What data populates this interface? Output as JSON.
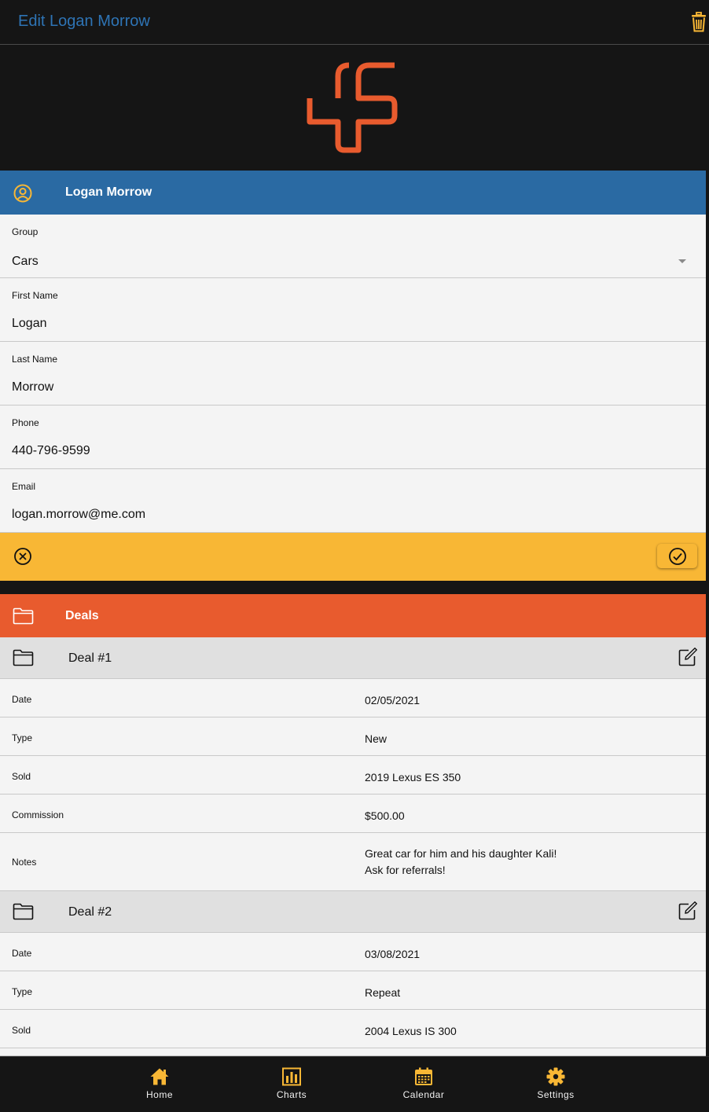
{
  "header": {
    "title": "Edit Logan Morrow",
    "delete_icon": "trash-icon"
  },
  "logo": {
    "icon": "brand-logo",
    "color": "#e85b2e"
  },
  "contact": {
    "section_title": "Logan Morrow",
    "section_icon": "user-circle-icon",
    "fields": {
      "group": {
        "label": "Group",
        "value": "Cars"
      },
      "first_name": {
        "label": "First Name",
        "value": "Logan"
      },
      "last_name": {
        "label": "Last Name",
        "value": "Morrow"
      },
      "phone": {
        "label": "Phone",
        "value": "440-796-9599"
      },
      "email": {
        "label": "Email",
        "value": "logan.morrow@me.com"
      }
    }
  },
  "actions": {
    "cancel_icon": "cancel-circle-icon",
    "confirm_icon": "check-circle-icon"
  },
  "deals": {
    "section_title": "Deals",
    "section_icon": "folder-icon",
    "items": [
      {
        "title": "Deal #1",
        "rows": {
          "date": {
            "label": "Date",
            "value": "02/05/2021"
          },
          "type": {
            "label": "Type",
            "value": "New"
          },
          "sold": {
            "label": "Sold",
            "value": "2019 Lexus ES 350"
          },
          "commission": {
            "label": "Commission",
            "value": "$500.00"
          },
          "notes": {
            "label": "Notes",
            "line1": "Great car for him and his daughter Kali!",
            "line2": "Ask for referrals!"
          }
        }
      },
      {
        "title": "Deal #2",
        "rows": {
          "date": {
            "label": "Date",
            "value": "03/08/2021"
          },
          "type": {
            "label": "Type",
            "value": "Repeat"
          },
          "sold": {
            "label": "Sold",
            "value": "2004 Lexus IS 300"
          }
        }
      }
    ]
  },
  "nav": {
    "items": [
      {
        "label": "Home",
        "icon": "home-icon"
      },
      {
        "label": "Charts",
        "icon": "bar-chart-icon"
      },
      {
        "label": "Calendar",
        "icon": "calendar-icon"
      },
      {
        "label": "Settings",
        "icon": "gear-icon"
      }
    ],
    "icon_color": "#f8b735"
  },
  "colors": {
    "background": "#151515",
    "title_blue": "#2e74b5",
    "contact_header": "#2a6aa3",
    "deals_header": "#e85b2e",
    "action_bar": "#f8b735"
  }
}
